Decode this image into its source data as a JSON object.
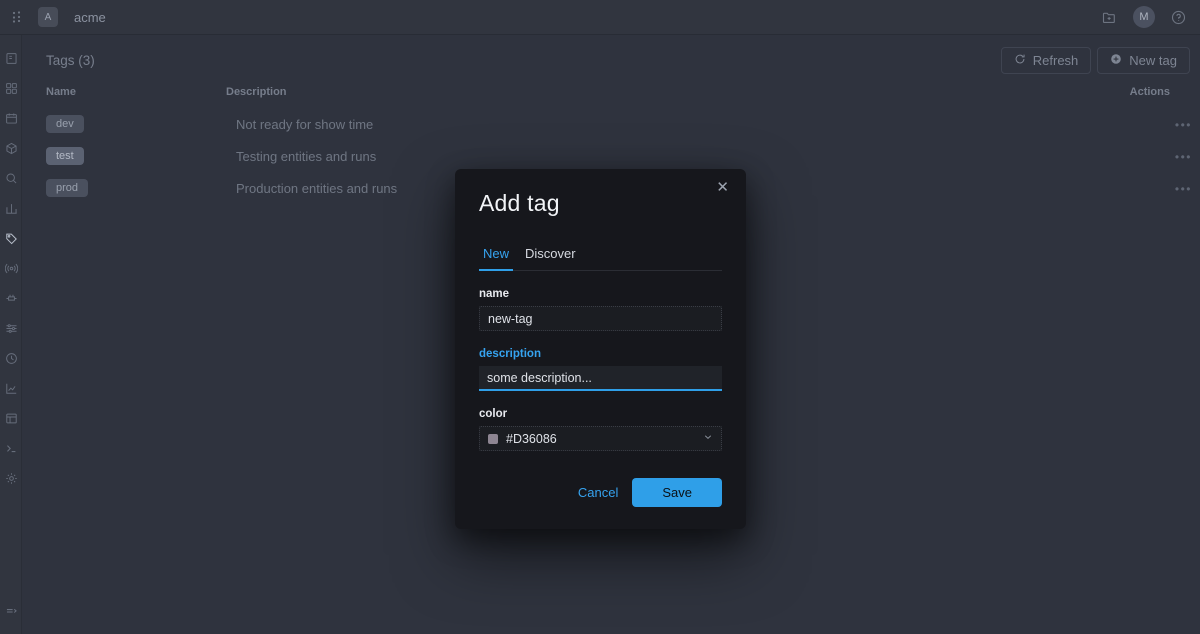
{
  "topbar": {
    "grid_icon": "grid-dots-icon",
    "org_avatar": "A",
    "brand": "acme",
    "folder_icon": "folder-plus-icon",
    "user_avatar": "M",
    "help_icon": "help-circle-icon"
  },
  "sidebar": {
    "items": [
      {
        "icon": "book-icon",
        "name": "sidebar-item-overview"
      },
      {
        "icon": "grid-icon",
        "name": "sidebar-item-dashboard"
      },
      {
        "icon": "calendar-icon",
        "name": "sidebar-item-calendar"
      },
      {
        "icon": "cube-icon",
        "name": "sidebar-item-packages"
      },
      {
        "icon": "search-icon",
        "name": "sidebar-item-search"
      },
      {
        "icon": "chart-bar-icon",
        "name": "sidebar-item-analytics"
      },
      {
        "icon": "tag-icon",
        "name": "sidebar-item-tags"
      },
      {
        "icon": "broadcast-icon",
        "name": "sidebar-item-streams"
      },
      {
        "icon": "plug-icon",
        "name": "sidebar-item-integrations"
      },
      {
        "icon": "sliders-icon",
        "name": "sidebar-item-filters"
      },
      {
        "icon": "clock-icon",
        "name": "sidebar-item-history"
      },
      {
        "icon": "chart-line-icon",
        "name": "sidebar-item-metrics"
      },
      {
        "icon": "table-icon",
        "name": "sidebar-item-reports"
      },
      {
        "icon": "terminal-icon",
        "name": "sidebar-item-console"
      },
      {
        "icon": "gear-icon",
        "name": "sidebar-item-settings"
      }
    ],
    "collapse_icon": "collapse-panel-icon"
  },
  "page": {
    "title": "Tags (3)",
    "refresh_label": "Refresh",
    "refresh_icon": "refresh-icon",
    "new_tag_label": "New tag",
    "new_tag_icon": "plus-circle-icon"
  },
  "table": {
    "headers": {
      "name": "Name",
      "description": "Description",
      "actions": "Actions"
    },
    "rows": [
      {
        "name": "dev",
        "description": "Not ready for show time",
        "actions": "•••",
        "highlight": false
      },
      {
        "name": "test",
        "description": "Testing entities and runs",
        "actions": "•••",
        "highlight": true
      },
      {
        "name": "prod",
        "description": "Production entities and runs",
        "actions": "•••",
        "highlight": false
      }
    ]
  },
  "modal": {
    "title": "Add tag",
    "close_icon": "close-icon",
    "tabs": [
      {
        "label": "New",
        "active": true
      },
      {
        "label": "Discover",
        "active": false
      }
    ],
    "fields": {
      "name": {
        "label": "name",
        "value": "new-tag",
        "placeholder": "new-tag"
      },
      "description": {
        "label": "description",
        "value": "some description...",
        "placeholder": "some description..."
      },
      "color": {
        "label": "color",
        "value": "#D36086",
        "swatch": "#D36086",
        "chevron_icon": "chevron-down-icon"
      }
    },
    "cancel_label": "Cancel",
    "save_label": "Save"
  },
  "colors": {
    "accent": "#2F9FE8",
    "page_bg": "#2F333E",
    "modal_bg": "#16171C",
    "tag_color": "#D36086"
  }
}
